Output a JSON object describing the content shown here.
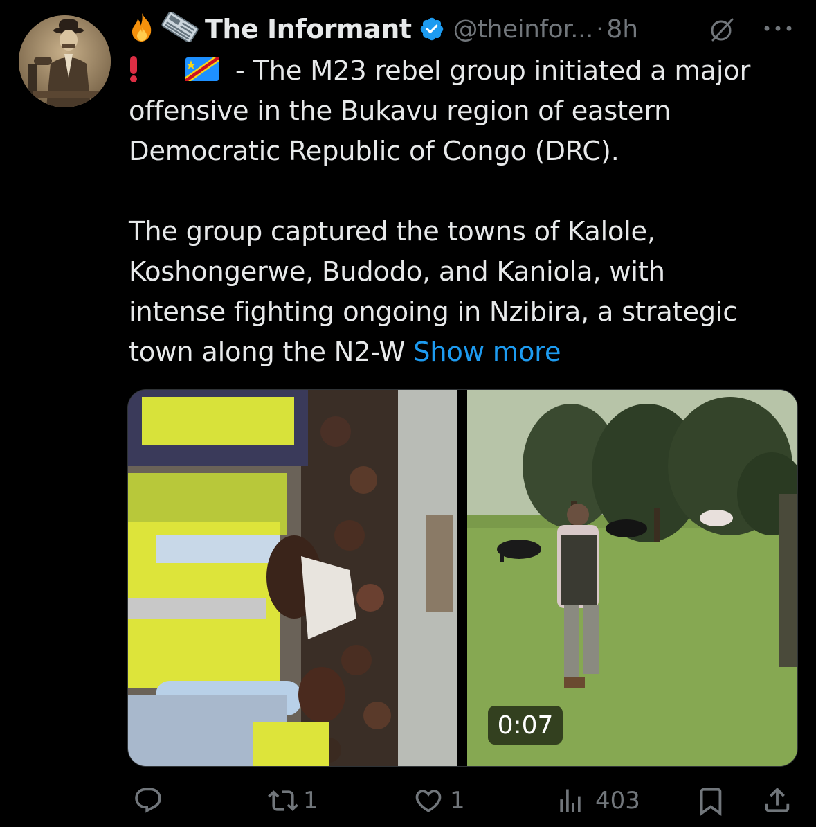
{
  "tweet": {
    "author_name": "The Informant",
    "handle": "@theinfor...",
    "separator": "·",
    "time": "8h",
    "lines": [
      "- The M23 rebel group initiated a major",
      "offensive in the Bukavu region of eastern",
      "Democratic Republic of Congo (DRC).",
      "",
      "The group captured the towns of Kalole,",
      "Koshongerwe, Budodo, and Kaniola, with",
      "intense fighting ongoing in Nzibira, a strategic",
      "town along the N2-W"
    ],
    "show_more": "Show more",
    "video_duration": "0:07"
  },
  "icons": {
    "name_prefix": [
      "fire-emoji",
      "newspaper-emoji"
    ],
    "text_prefix": [
      "exclamation-emoji",
      "drc-flag-emoji"
    ],
    "verified": "verified-badge-icon",
    "grok": "grok-icon",
    "more": "more-icon"
  },
  "actions": {
    "reply_count": "",
    "repost_count": "1",
    "like_count": "1",
    "views_count": "403"
  },
  "colors": {
    "background": "#000000",
    "text": "#e7e9ea",
    "secondary": "#71767b",
    "link": "#1d9bf0",
    "verified": "#1d9bf0"
  }
}
